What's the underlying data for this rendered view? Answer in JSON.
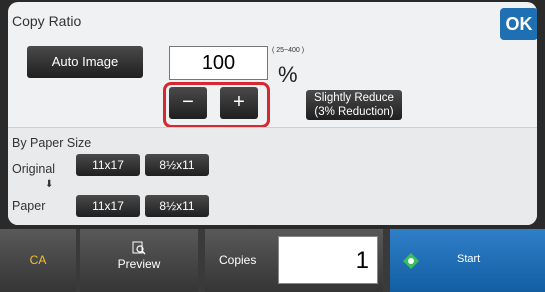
{
  "panel": {
    "title": "Copy Ratio",
    "ok_label": "OK",
    "auto_image_label": "Auto Image",
    "ratio_value": "100",
    "range_label": "( 25~400 )",
    "percent_label": "%",
    "minus_label": "−",
    "plus_label": "+",
    "slightly_reduce_line1": "Slightly Reduce",
    "slightly_reduce_line2": "(3% Reduction)"
  },
  "paper": {
    "section_label": "By Paper Size",
    "original_label": "Original",
    "paper_label": "Paper",
    "arrow": "⬇",
    "original_sizes": [
      "11x17",
      "8½x11"
    ],
    "paper_sizes": [
      "11x17",
      "8½x11"
    ]
  },
  "bottom": {
    "ca_label": "CA",
    "preview_label": "Preview",
    "copies_label": "Copies",
    "copies_value": "1",
    "start_label": "Start"
  },
  "colors": {
    "accent_blue": "#1f6fb3",
    "highlight_red": "#d7282f",
    "ca_yellow": "#f0c22d"
  },
  "icons": {
    "preview": "magnifier-document-icon",
    "start": "diamond-start-icon"
  }
}
